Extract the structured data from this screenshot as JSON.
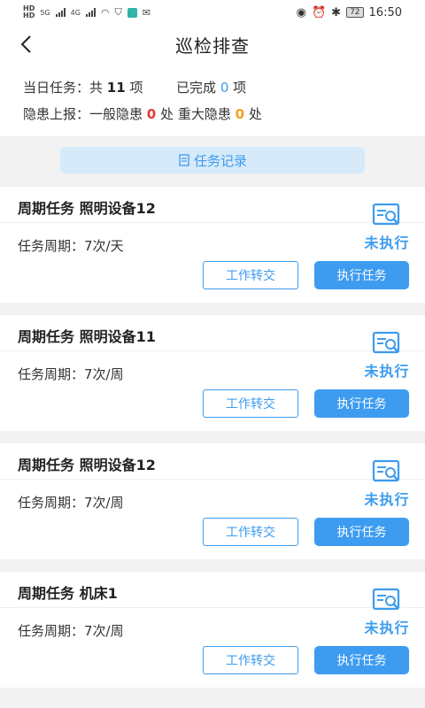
{
  "status_bar": {
    "left_tag_1": "HD",
    "left_tag_2": "HD",
    "net_1": "5G",
    "net_2": "4G",
    "battery": "72",
    "time": "16:50"
  },
  "header": {
    "title": "巡检排查"
  },
  "summary": {
    "task_label": "当日任务：共",
    "task_total": "11",
    "task_unit": "项",
    "done_label": "已完成",
    "done_count": "0",
    "done_unit": "项",
    "hazard_label": "隐患上报：一般隐患",
    "general_count": "0",
    "general_unit": "处",
    "major_label": "重大隐患",
    "major_count": "0",
    "major_unit": "处"
  },
  "record_button": "任务记录",
  "tasks": [
    {
      "title": "周期任务 照明设备12",
      "period": "任务周期：7次/天",
      "status": "未执行",
      "transfer": "工作转交",
      "execute": "执行任务"
    },
    {
      "title": "周期任务 照明设备11",
      "period": "任务周期：7次/周",
      "status": "未执行",
      "transfer": "工作转交",
      "execute": "执行任务"
    },
    {
      "title": "周期任务 照明设备12",
      "period": "任务周期：7次/周",
      "status": "未执行",
      "transfer": "工作转交",
      "execute": "执行任务"
    },
    {
      "title": "周期任务 机床1",
      "period": "任务周期：7次/周",
      "status": "未执行",
      "transfer": "工作转交",
      "execute": "执行任务"
    }
  ],
  "colors": {
    "accent": "#3d9cf0",
    "danger": "#e23b3b",
    "warning": "#f0a020"
  }
}
